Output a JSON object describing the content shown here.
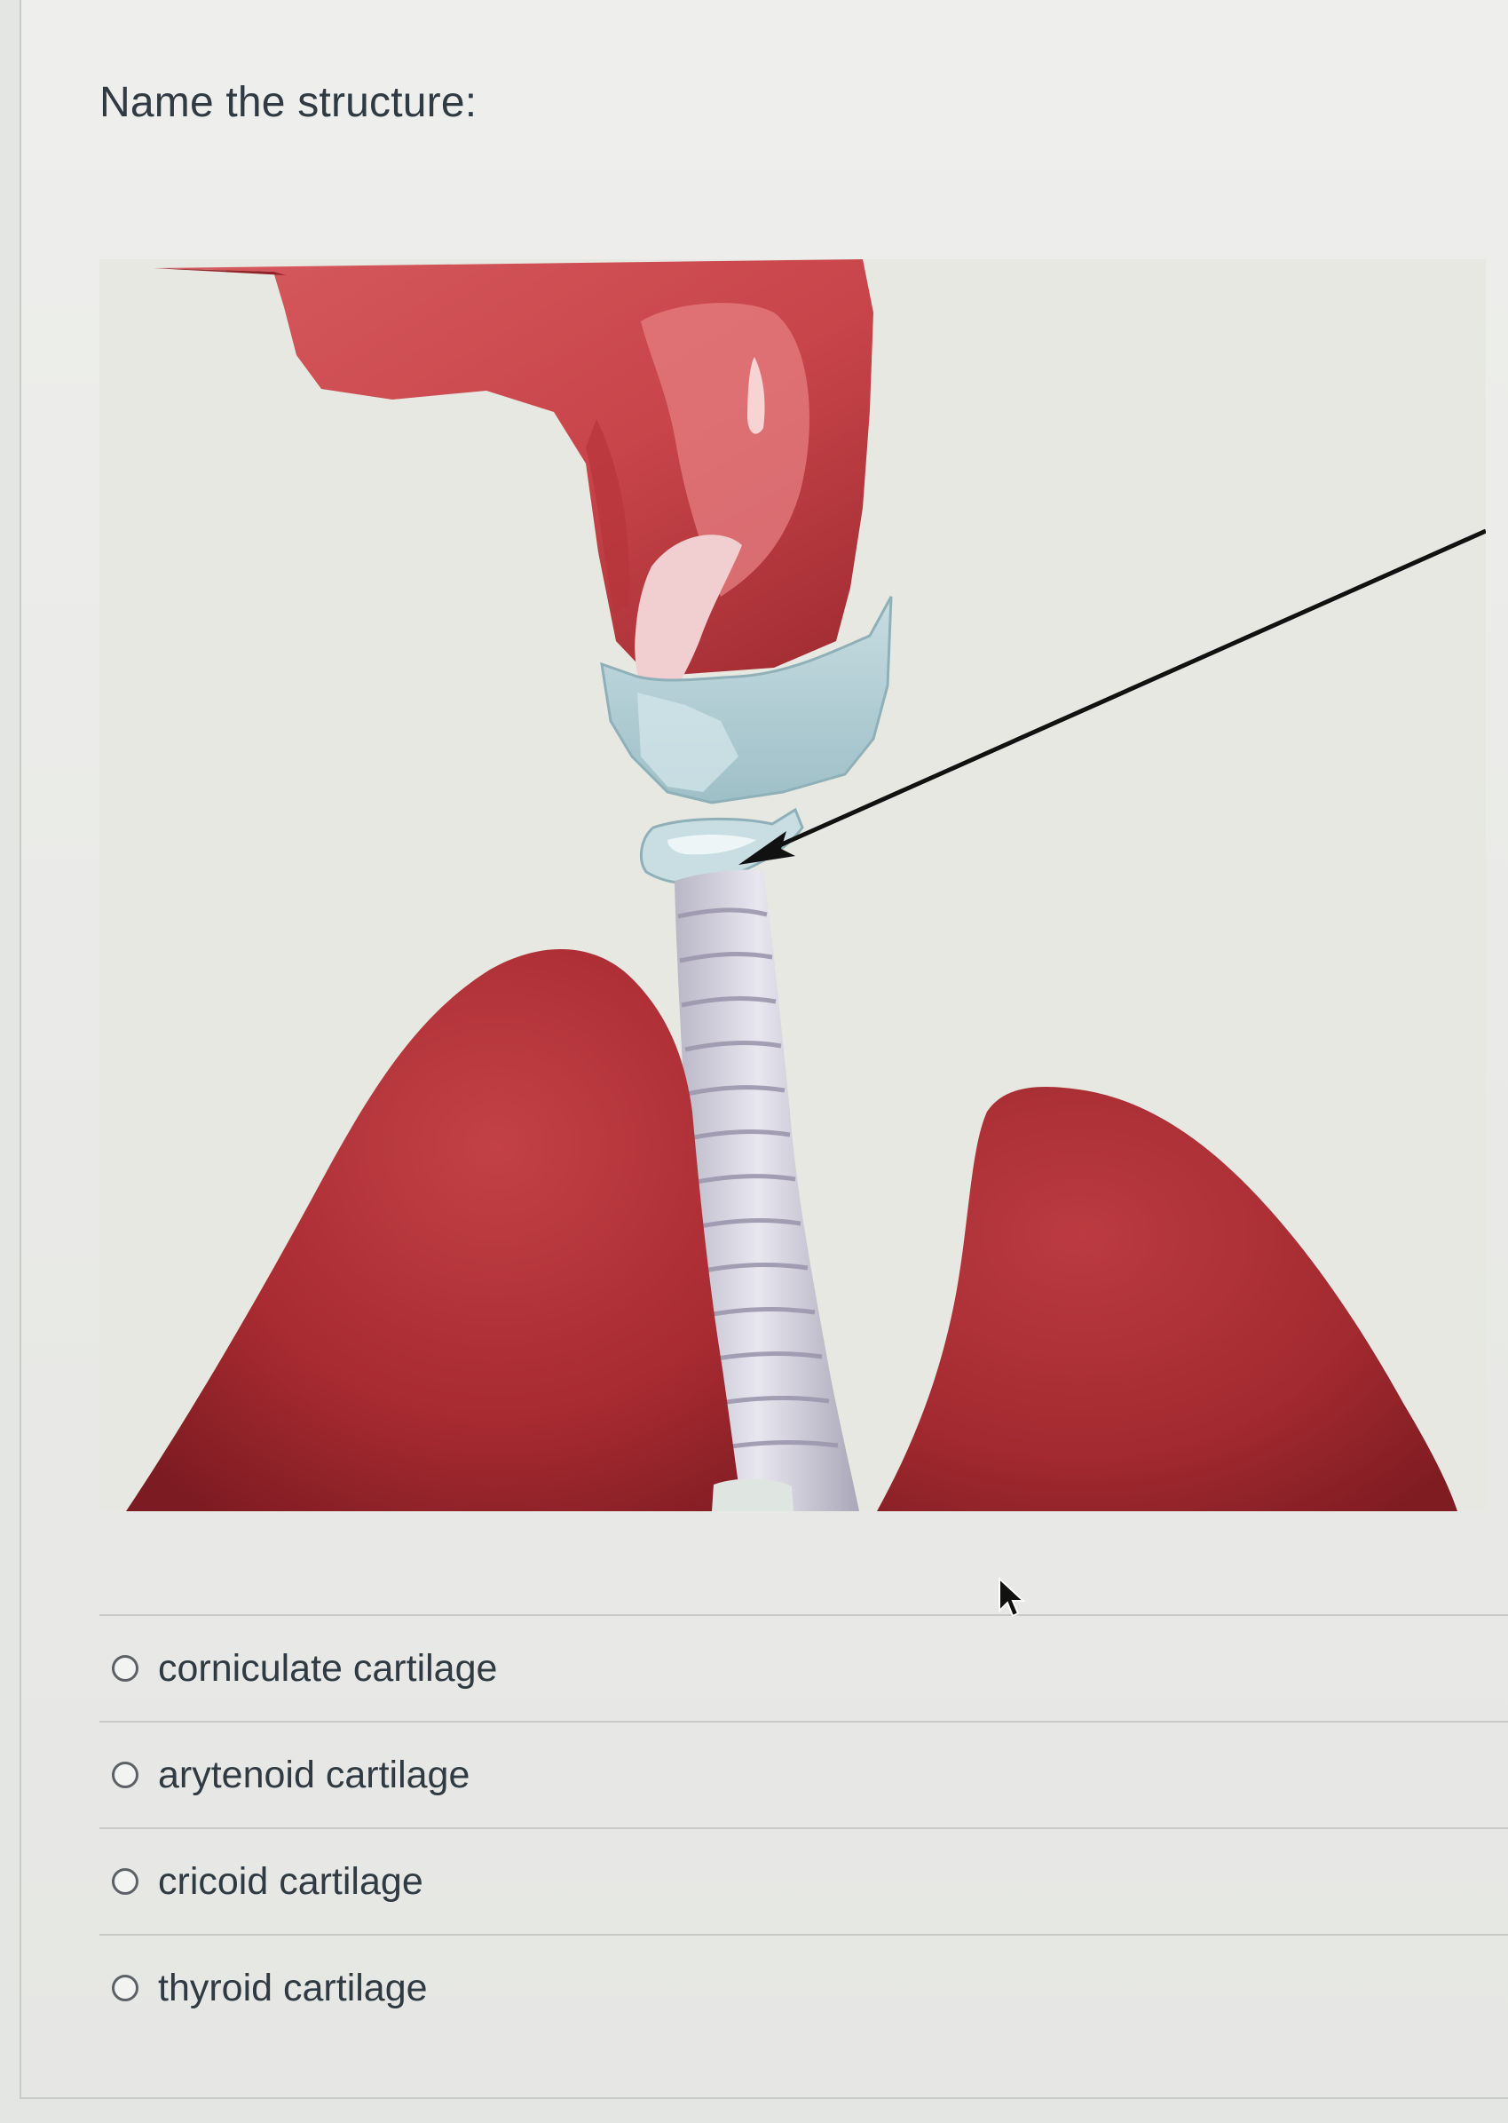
{
  "question": {
    "prompt": "Name the structure:"
  },
  "figure": {
    "icon": "anatomy-illustration-larynx-trachea-lungs",
    "pointer": "arrow"
  },
  "answers": [
    {
      "label": "corniculate cartilage",
      "selected": false
    },
    {
      "label": "arytenoid cartilage",
      "selected": false
    },
    {
      "label": "cricoid cartilage",
      "selected": false
    },
    {
      "label": "thyroid cartilage",
      "selected": false
    }
  ],
  "cursor": {
    "icon": "mouse-pointer-icon"
  },
  "colors": {
    "tissue": "#c8454a",
    "lung": "#a82b31",
    "cartilage": "#b7d2d8",
    "trachea": "#d9d7e2",
    "arrow": "#111111",
    "text": "#2f3a42"
  }
}
